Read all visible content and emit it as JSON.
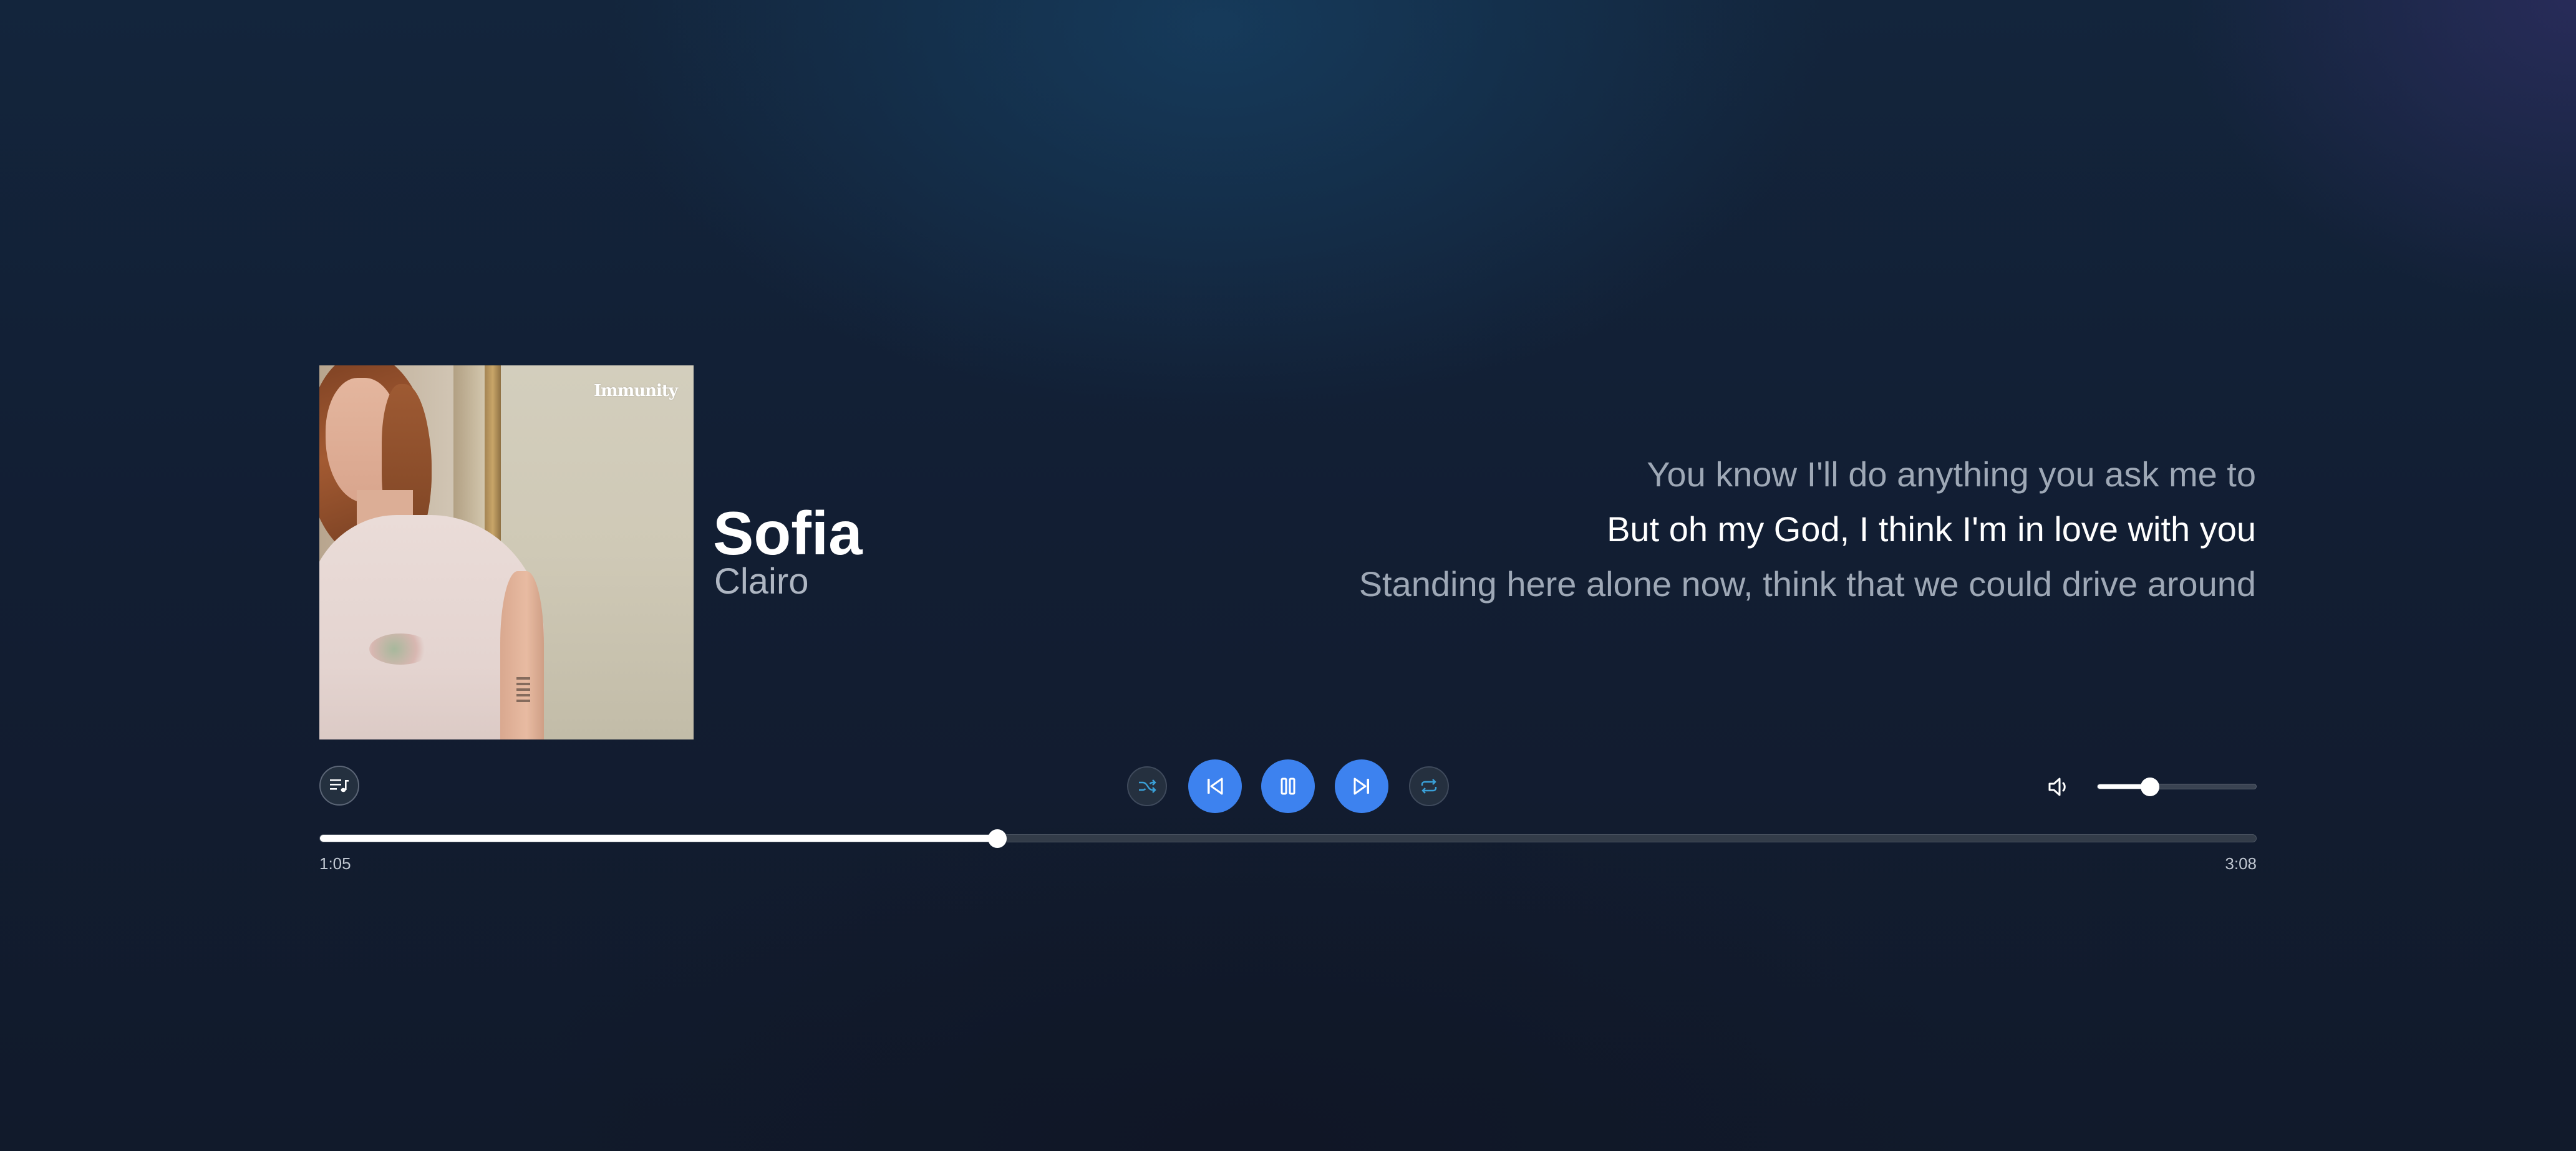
{
  "track": {
    "title": "Sofia",
    "artist": "Clairo",
    "album_logo_text": "Immunity"
  },
  "lyrics": {
    "previous": "You know I'll do anything you ask me to",
    "current": "But oh my God, I think I'm in love with you",
    "next": "Standing here alone now, think that we could drive around"
  },
  "controls": {
    "queue_icon": "queue-music-icon",
    "shuffle_icon": "shuffle-icon",
    "previous_icon": "skip-previous-icon",
    "pause_icon": "pause-icon",
    "next_icon": "skip-next-icon",
    "repeat_icon": "repeat-icon",
    "volume_icon": "volume-icon",
    "accent_color": "#3d82ef",
    "volume_level": 0.33
  },
  "progress": {
    "elapsed": "1:05",
    "total": "3:08",
    "fraction": 0.35
  }
}
